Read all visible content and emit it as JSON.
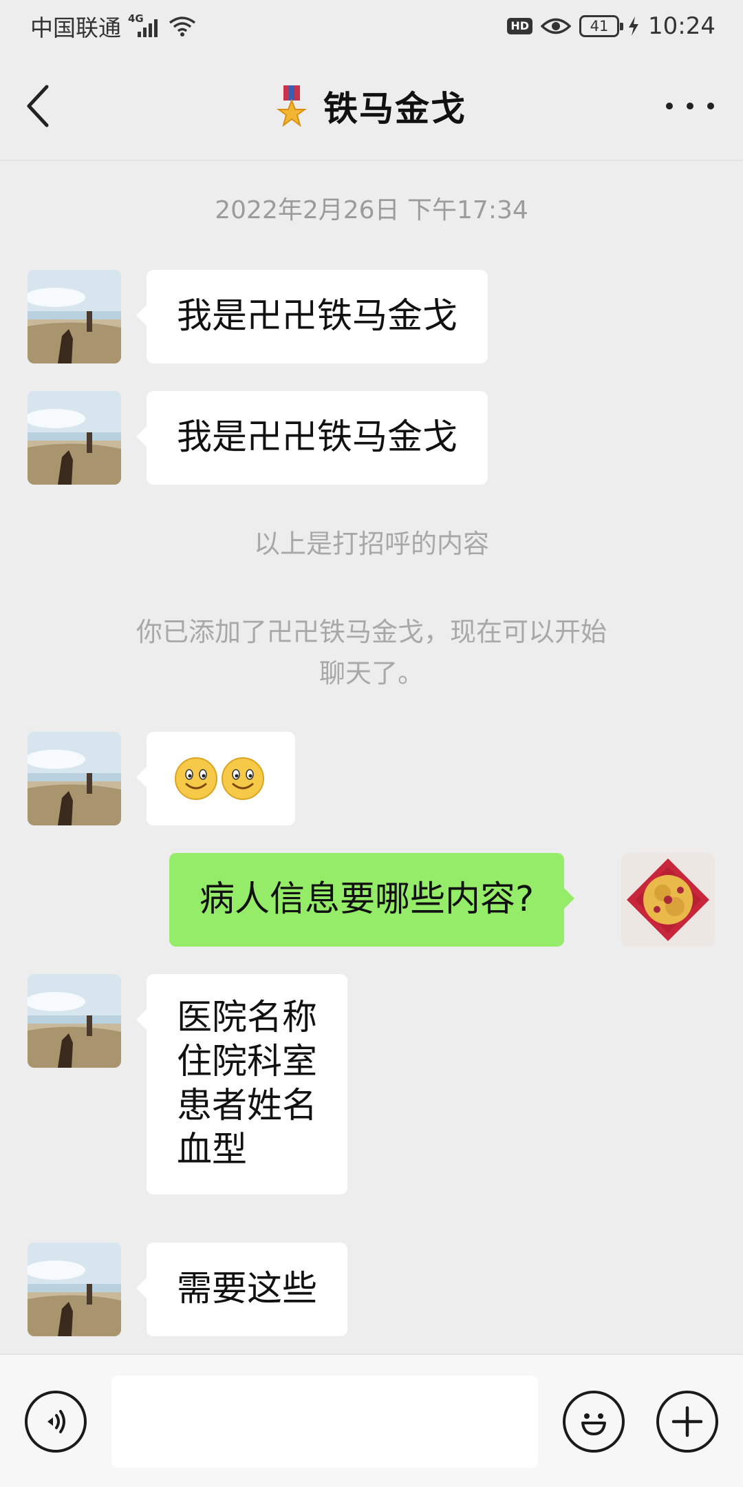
{
  "status_bar": {
    "carrier": "中国联通",
    "network": "4G",
    "hd": "HD",
    "battery": "41",
    "time": "10:24"
  },
  "nav": {
    "title": "铁马金戈",
    "title_icon": "medal-icon"
  },
  "chat": {
    "timestamp": "2022年2月26日 下午17:34",
    "messages": [
      {
        "side": "in",
        "text": "我是卍卍铁马金戈"
      },
      {
        "side": "in",
        "text": "我是卍卍铁马金戈"
      }
    ],
    "system_1": "以上是打招呼的内容",
    "system_2_line1": "你已添加了卍卍铁马金戈，现在可以开始",
    "system_2_line2": "聊天了。",
    "emoji_message": {
      "side": "in",
      "emoji": [
        "smile-emoji",
        "smile-emoji"
      ]
    },
    "outgoing": {
      "side": "out",
      "text": "病人信息要哪些内容?"
    },
    "list_message": {
      "side": "in",
      "lines": [
        "医院名称",
        "住院科室",
        "患者姓名",
        "血型"
      ]
    },
    "last_message": {
      "side": "in",
      "text": "需要这些"
    }
  },
  "input_bar": {
    "voice_icon": "voice-icon",
    "emoji_icon": "emoji-icon",
    "plus_icon": "plus-icon",
    "input_value": ""
  },
  "colors": {
    "background": "#ededed",
    "bubble_in": "#ffffff",
    "bubble_out": "#95ec69",
    "system_text": "#a8a8a8"
  }
}
